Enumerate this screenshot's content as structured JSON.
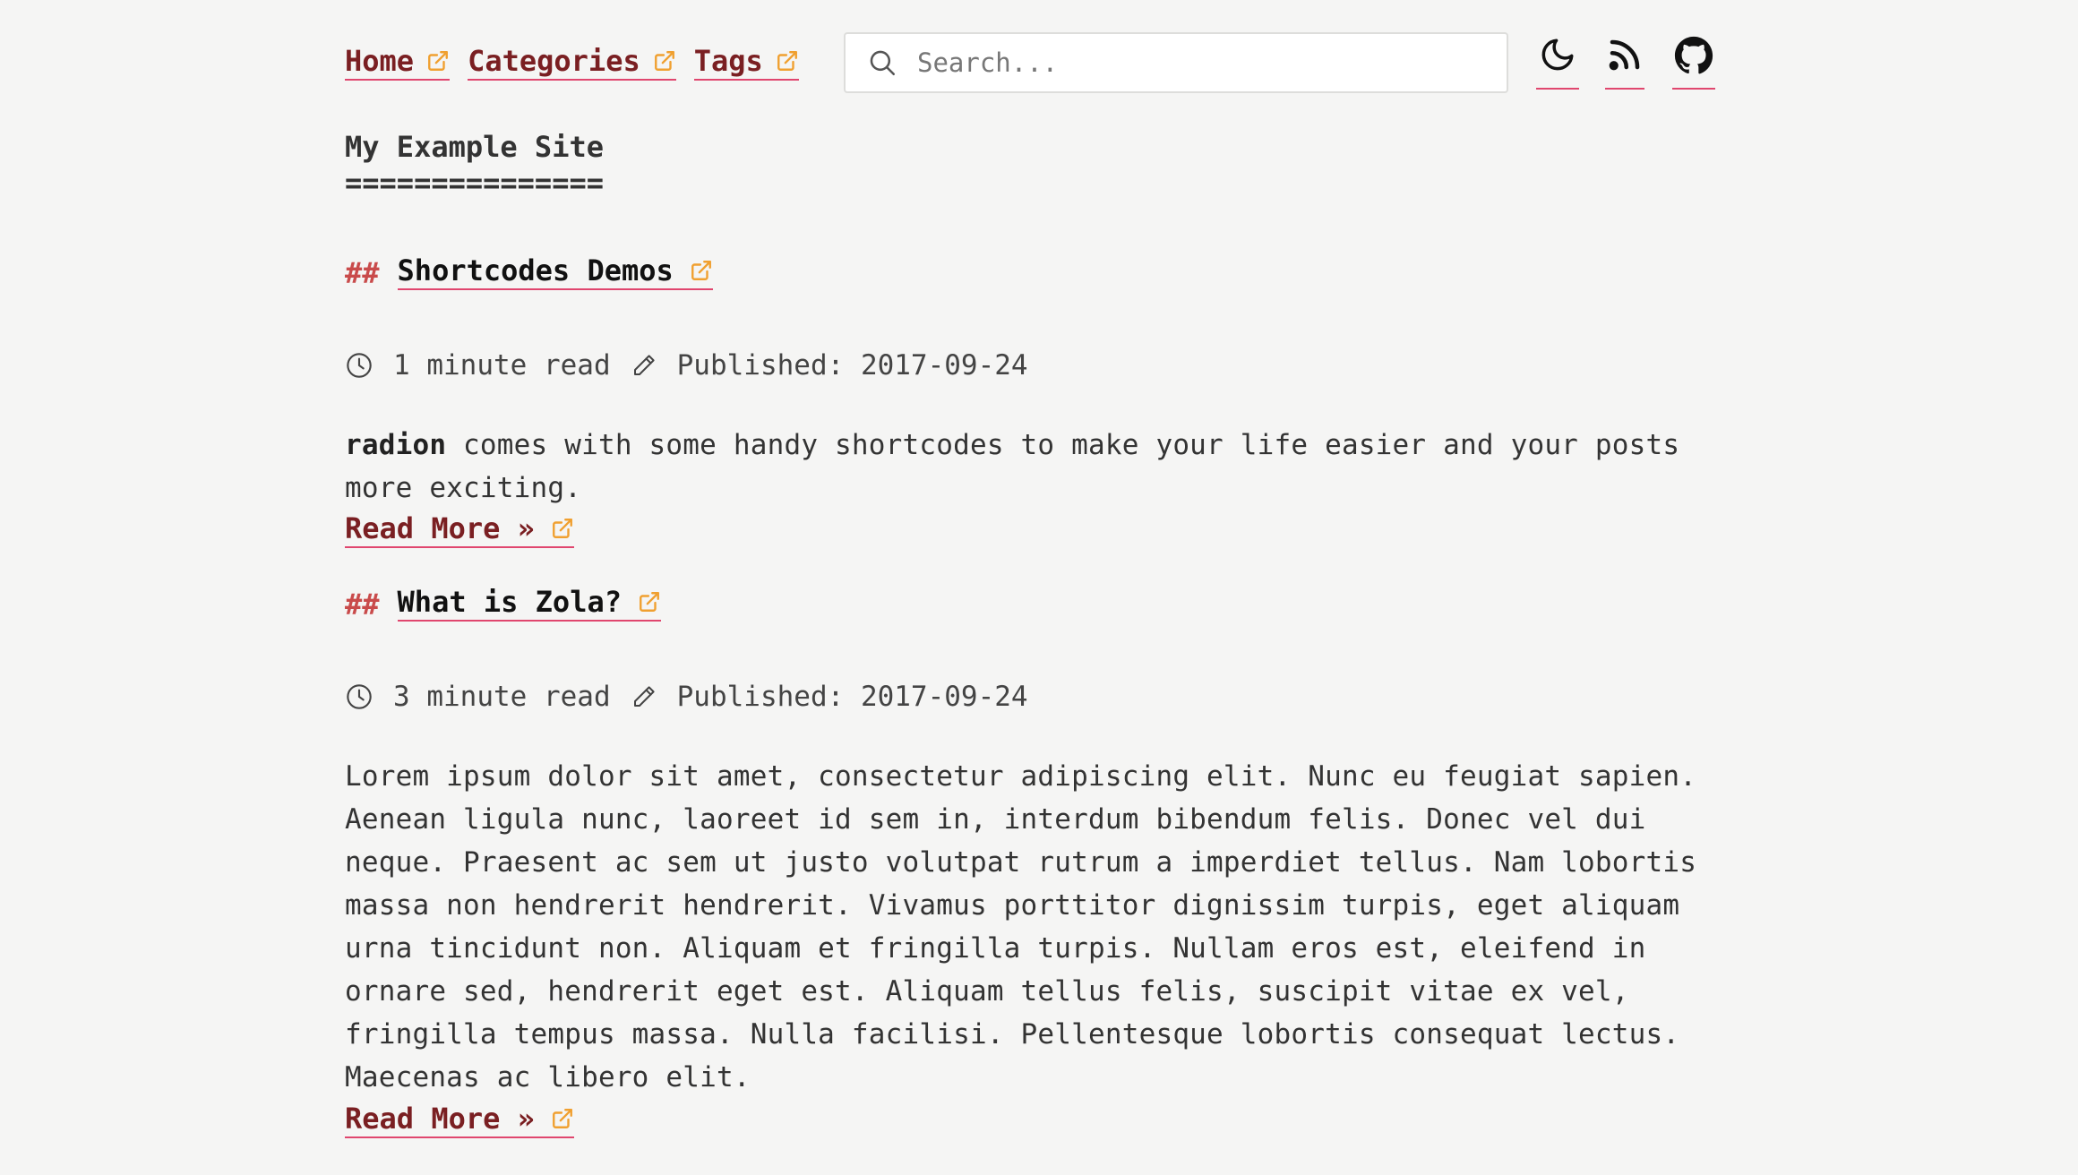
{
  "nav": {
    "links": [
      {
        "label": "Home"
      },
      {
        "label": "Categories"
      },
      {
        "label": "Tags"
      }
    ]
  },
  "search": {
    "placeholder": "Search...",
    "value": ""
  },
  "header_icons": [
    "moon-icon",
    "rss-icon",
    "github-icon"
  ],
  "site": {
    "title": "My Example Site",
    "underline": "==============="
  },
  "posts": [
    {
      "hashes": "##",
      "title": "Shortcodes Demos",
      "read_time": "1 minute read",
      "published": "Published: 2017-09-24",
      "excerpt_bold": "radion",
      "excerpt_rest": " comes with some handy shortcodes to make your life easier and your posts more exciting.",
      "read_more": "Read More »"
    },
    {
      "hashes": "##",
      "title": "What is Zola?",
      "read_time": "3 minute read",
      "published": "Published: 2017-09-24",
      "excerpt": "Lorem ipsum dolor sit amet, consectetur adipiscing elit. Nunc eu feugiat sapien. Aenean ligula nunc, laoreet id sem in, interdum bibendum felis. Donec vel dui neque. Praesent ac sem ut justo volutpat rutrum a imperdiet tellus. Nam lobortis massa non hendrerit hendrerit. Vivamus porttitor dignissim turpis, eget aliquam urna tincidunt non. Aliquam et fringilla turpis. Nullam eros est, eleifend in ornare sed, hendrerit eget est. Aliquam tellus felis, suscipit vitae ex vel, fringilla tempus massa. Nulla facilisi. Pellentesque lobortis consequat lectus. Maecenas ac libero elit.",
      "read_more": "Read More »"
    }
  ],
  "colors": {
    "background": "#f5f5f4",
    "link": "#7a1f22",
    "underline": "#e0466e",
    "external_icon": "#f0a030",
    "hashes": "#c94b4b"
  }
}
